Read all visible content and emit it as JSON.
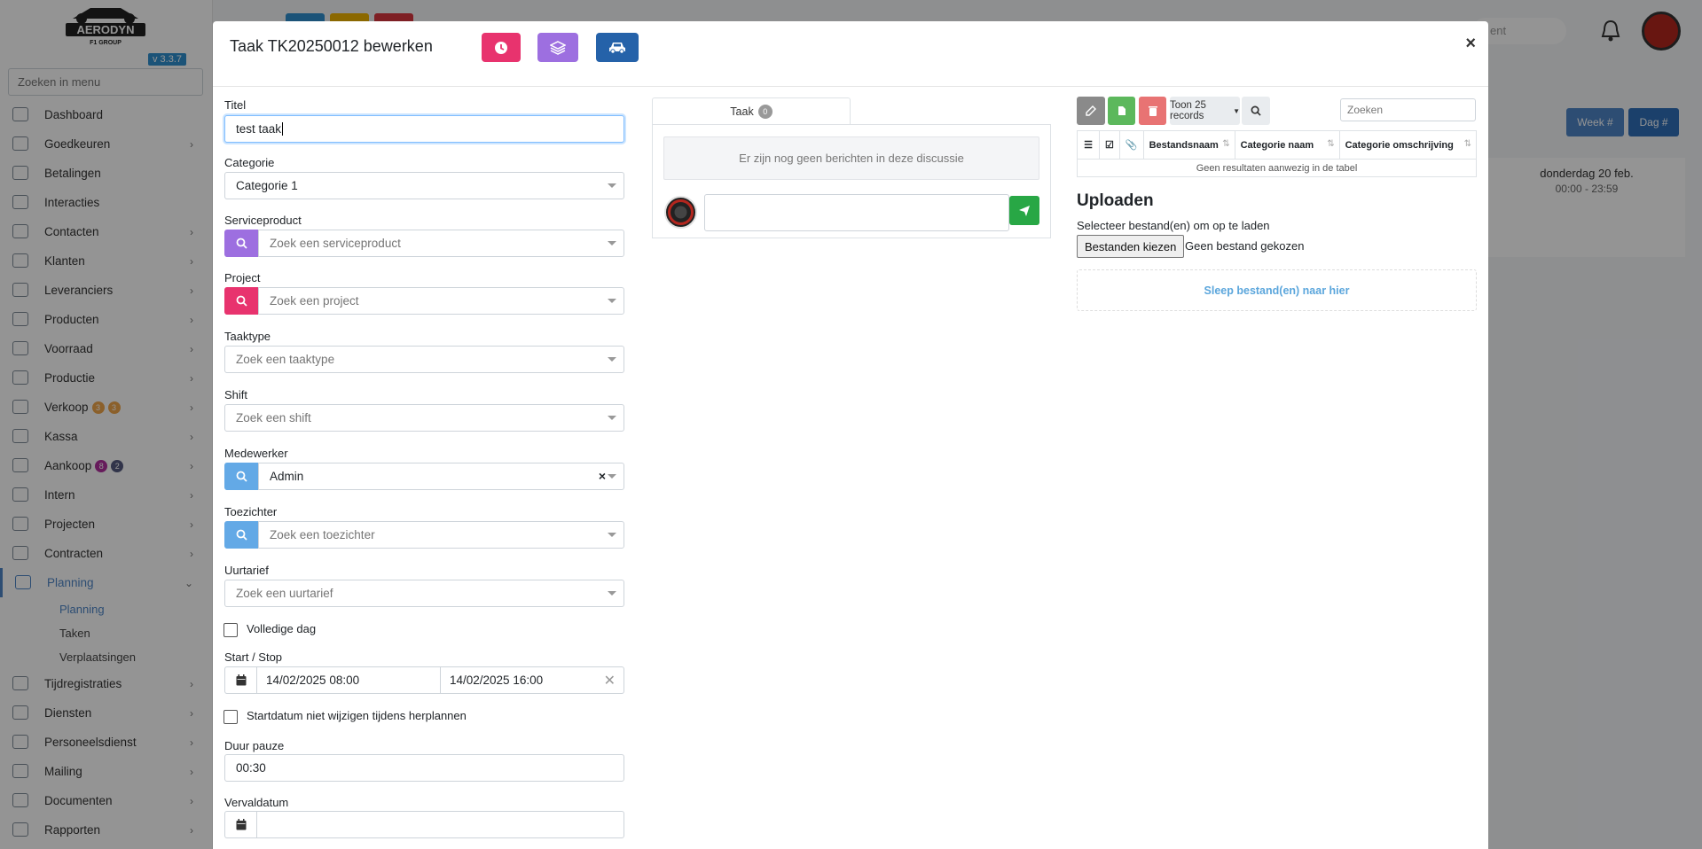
{
  "app": {
    "version": "v 3.3.7",
    "menu_search_placeholder": "Zoeken in menu"
  },
  "sidebar": {
    "items": [
      {
        "label": "Dashboard",
        "icon": "gauge-icon",
        "chevron": false
      },
      {
        "label": "Goedkeuren",
        "icon": "user-check-icon",
        "chevron": true
      },
      {
        "label": "Betalingen",
        "icon": "money-icon",
        "chevron": false
      },
      {
        "label": "Interacties",
        "icon": "comments-icon",
        "chevron": false
      },
      {
        "label": "Contacten",
        "icon": "address-card-icon",
        "chevron": true
      },
      {
        "label": "Klanten",
        "icon": "user-icon",
        "chevron": true
      },
      {
        "label": "Leveranciers",
        "icon": "truck-icon",
        "chevron": true
      },
      {
        "label": "Producten",
        "icon": "box-icon",
        "chevron": true
      },
      {
        "label": "Voorraad",
        "icon": "boxes-icon",
        "chevron": true
      },
      {
        "label": "Productie",
        "icon": "cogs-icon",
        "chevron": true
      },
      {
        "label": "Verkoop",
        "icon": "euro-icon",
        "chevron": true,
        "badges": [
          {
            "value": "3",
            "color": "#f0a64a"
          },
          {
            "value": "3",
            "color": "#f0a64a"
          }
        ]
      },
      {
        "label": "Kassa",
        "icon": "basket-icon",
        "chevron": true
      },
      {
        "label": "Aankoop",
        "icon": "cart-icon",
        "chevron": true,
        "badges": [
          {
            "value": "8",
            "color": "#b0309e"
          },
          {
            "value": "2",
            "color": "#555a80"
          }
        ]
      },
      {
        "label": "Intern",
        "icon": "users-icon",
        "chevron": true
      },
      {
        "label": "Projecten",
        "icon": "project-icon",
        "chevron": true
      },
      {
        "label": "Contracten",
        "icon": "contract-icon",
        "chevron": true
      },
      {
        "label": "Planning",
        "icon": "calendar-icon",
        "chevron": true,
        "active": true
      }
    ],
    "sub_items": [
      {
        "label": "Planning",
        "active": true
      },
      {
        "label": "Taken"
      },
      {
        "label": "Verplaatsingen"
      }
    ],
    "items_after": [
      {
        "label": "Tijdregistraties",
        "icon": "clock-icon",
        "chevron": true
      },
      {
        "label": "Diensten",
        "icon": "sync-icon",
        "chevron": true
      },
      {
        "label": "Personeelsdienst",
        "icon": "person-icon",
        "chevron": true
      },
      {
        "label": "Mailing",
        "icon": "paper-plane-icon",
        "chevron": true
      },
      {
        "label": "Documenten",
        "icon": "folder-icon",
        "chevron": true
      },
      {
        "label": "Rapporten",
        "icon": "chart-line-icon",
        "chevron": true
      }
    ]
  },
  "background": {
    "search_text": "ent",
    "week_label": "Week #",
    "day_label": "Dag #",
    "calendar_day": "donderdag 20 feb.",
    "calendar_time": "00:00 - 23:59"
  },
  "modal": {
    "title": "Taak TK20250012 bewerken",
    "header_buttons": [
      {
        "icon": "clock-icon",
        "color": "#e8336e"
      },
      {
        "icon": "layers-icon",
        "color": "#9d6fe0"
      },
      {
        "icon": "car-icon",
        "color": "#2562a9"
      }
    ],
    "close_label": "×",
    "form": {
      "titel_label": "Titel",
      "titel_value": "test taak",
      "categorie_label": "Categorie",
      "categorie_value": "Categorie 1",
      "serviceproduct_label": "Serviceproduct",
      "serviceproduct_placeholder": "Zoek een serviceproduct",
      "project_label": "Project",
      "project_placeholder": "Zoek een project",
      "taaktype_label": "Taaktype",
      "taaktype_placeholder": "Zoek een taaktype",
      "shift_label": "Shift",
      "shift_placeholder": "Zoek een shift",
      "medewerker_label": "Medewerker",
      "medewerker_value": "Admin",
      "clear_label": "×",
      "toezichter_label": "Toezichter",
      "toezichter_placeholder": "Zoek een toezichter",
      "uurtarief_label": "Uurtarief",
      "uurtarief_placeholder": "Zoek een uurtarief",
      "volledige_dag_label": "Volledige dag",
      "start_stop_label": "Start / Stop",
      "start_value": "14/02/2025 08:00",
      "stop_value": "14/02/2025 16:00",
      "startdatum_label": "Startdatum niet wijzigen tijdens herplannen",
      "duur_pauze_label": "Duur pauze",
      "duur_pauze_value": "00:30",
      "vervaldatum_label": "Vervaldatum"
    },
    "chat": {
      "tab_label": "Taak",
      "tab_count": "0",
      "empty_message": "Er zijn nog geen berichten in deze discussie"
    },
    "files": {
      "toolbar": {
        "records_label": "Toon 25 records",
        "search_placeholder": "Zoeken"
      },
      "columns": [
        "Bestandsnaam",
        "Categorie naam",
        "Categorie omschrijving"
      ],
      "empty_message": "Geen resultaten aanwezig in de tabel",
      "upload_title": "Uploaden",
      "upload_instruction": "Selecteer bestand(en) om op te laden",
      "choose_files_label": "Bestanden kiezen",
      "no_file_label": "Geen bestand gekozen",
      "drop_label": "Sleep bestand(en) naar hier"
    }
  }
}
